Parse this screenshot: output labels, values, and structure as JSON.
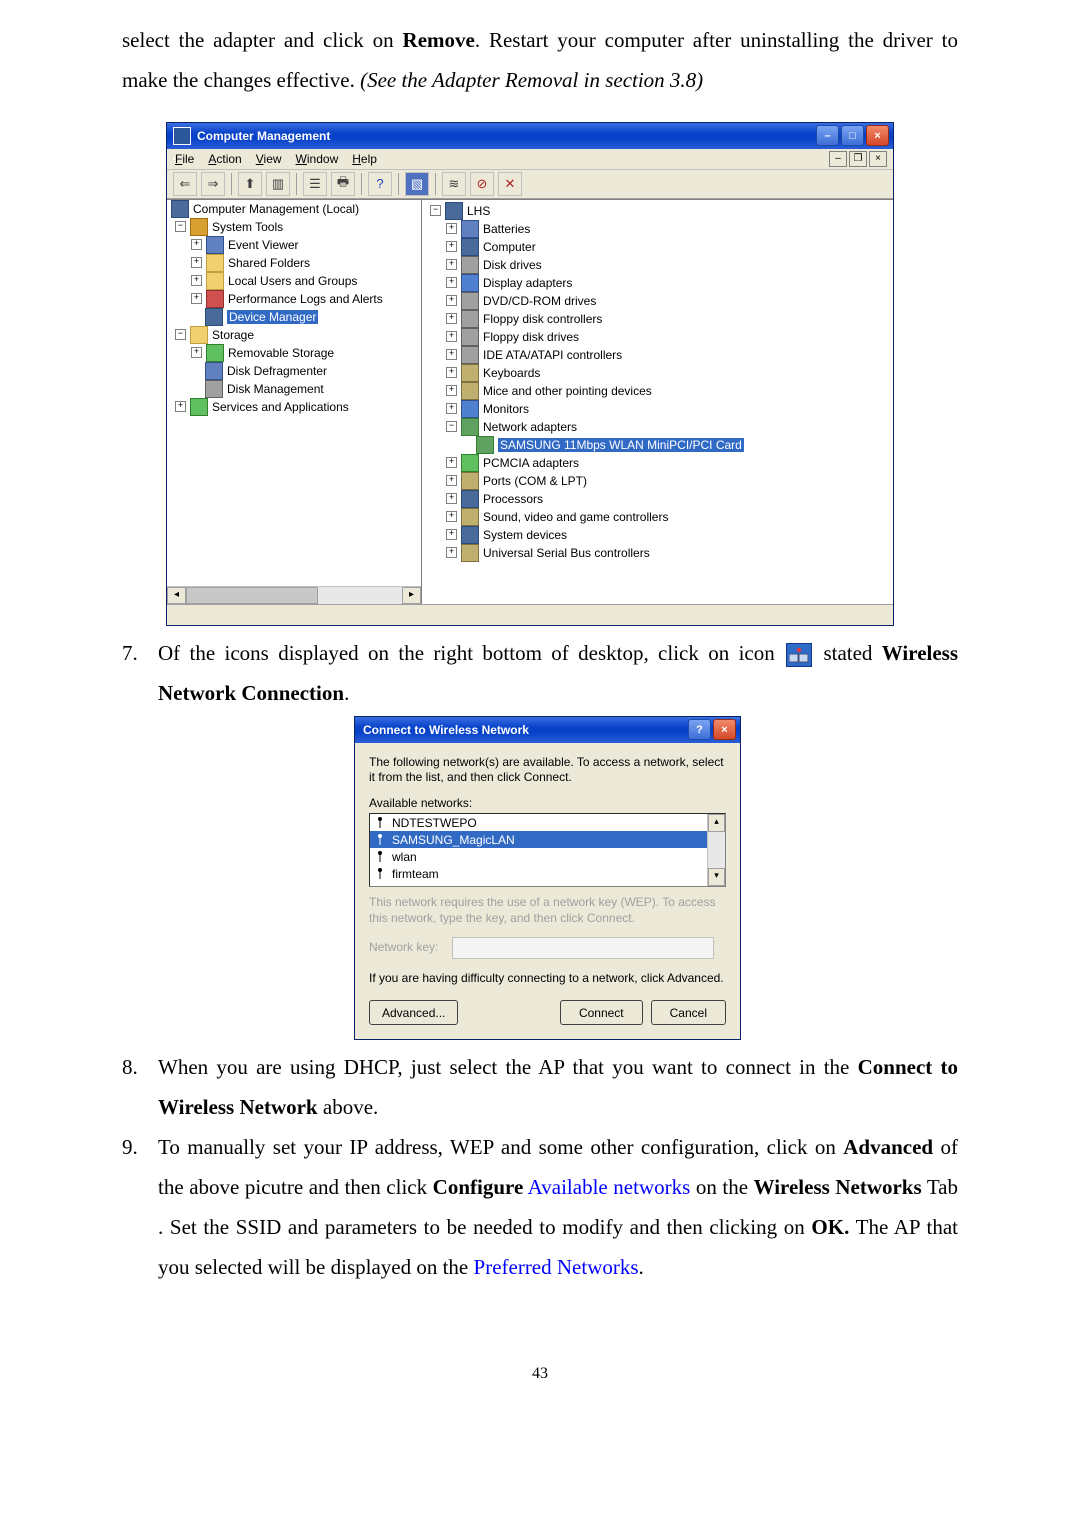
{
  "intro_paragraph": {
    "prefix": "select the adapter and click on ",
    "remove": "Remove",
    "mid": ". Restart your computer after uninstalling the driver to make the changes effective. ",
    "italic": "(See the Adapter Removal in section 3.8)"
  },
  "cm": {
    "title": "Computer Management",
    "menu": {
      "file": "File",
      "action": "Action",
      "view": "View",
      "window": "Window",
      "help": "Help"
    },
    "left_tree": {
      "root": "Computer Management (Local)",
      "system_tools": "System Tools",
      "event_viewer": "Event Viewer",
      "shared_folders": "Shared Folders",
      "local_users": "Local Users and Groups",
      "perf_logs": "Performance Logs and Alerts",
      "device_manager": "Device Manager",
      "storage": "Storage",
      "removable": "Removable Storage",
      "defrag": "Disk Defragmenter",
      "diskmgmt": "Disk Management",
      "services": "Services and Applications"
    },
    "right_tree": {
      "root": "LHS",
      "batteries": "Batteries",
      "computer": "Computer",
      "disk_drives": "Disk drives",
      "display": "Display adapters",
      "dvd": "DVD/CD-ROM drives",
      "floppy_ctrl": "Floppy disk controllers",
      "floppy_drv": "Floppy disk drives",
      "ide": "IDE ATA/ATAPI controllers",
      "keyboards": "Keyboards",
      "mice": "Mice and other pointing devices",
      "monitors": "Monitors",
      "net_adapters": "Network adapters",
      "samsung": "SAMSUNG 11Mbps WLAN MiniPCI/PCI Card",
      "pcmcia": "PCMCIA adapters",
      "ports": "Ports (COM & LPT)",
      "processors": "Processors",
      "sound": "Sound, video and game controllers",
      "sysdev": "System devices",
      "usb": "Universal Serial Bus controllers"
    }
  },
  "item7": {
    "prefix": "Of the icons displayed on the right bottom of desktop, click on icon ",
    "suffix": " stated ",
    "bold": "Wireless Network Connection",
    "dot": "."
  },
  "dlg": {
    "title": "Connect to Wireless Network",
    "desc": "The following network(s) are available. To access a network, select it from the list, and then click Connect.",
    "avail": "Available networks:",
    "nets": [
      "NDTESTWEPO",
      "SAMSUNG_MagicLAN",
      "wlan",
      "firmteam"
    ],
    "wep": "This network requires the use of a network key (WEP). To access this network, type the key, and then click Connect.",
    "keylabel": "Network key:",
    "diff": "If you are having difficulty connecting to a network, click Advanced.",
    "advanced": "Advanced...",
    "connect": "Connect",
    "cancel": "Cancel"
  },
  "item8": {
    "pre": "When you are using DHCP, just select the AP that you want to connect in the ",
    "bold": "Connect to Wireless Network",
    "post": " above."
  },
  "item9": {
    "p1": "To manually set your IP address, WEP and some other configuration, click on ",
    "adv": "Advanced",
    "p2": " of the above picutre and then click ",
    "conf": "Configure",
    "sp": " ",
    "avail": "Available networks",
    "p3": " on the ",
    "wn": "Wireless Networks",
    "p4": " Tab . Set the SSID and parameters to be needed to modify and then clicking on ",
    "ok": "OK.",
    "p5": " The AP that you selected will be displayed on the ",
    "pref": "Preferred Networks",
    "dot": "."
  },
  "page_number": "43"
}
